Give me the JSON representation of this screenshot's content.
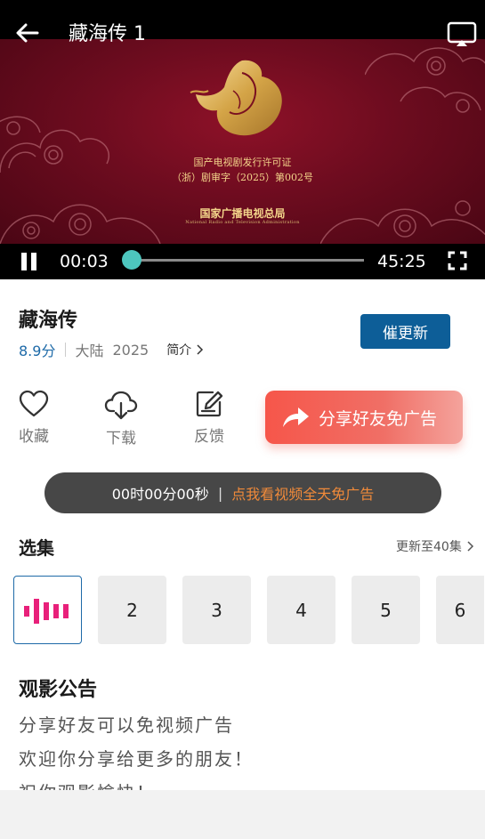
{
  "player": {
    "title": "藏海传 1",
    "frame_text": {
      "line1": "国产电视剧发行许可证",
      "line2": "（浙）剧审字（2025）第002号",
      "line3": "国家广播电视总局",
      "line4": "National Radio and Television Administration"
    },
    "current_time": "00:03",
    "total_time": "45:25",
    "progress": 0.001
  },
  "show": {
    "title": "藏海传",
    "rating": "8.9分",
    "region": "大陆",
    "year": "2025",
    "intro_label": "简介",
    "remind_label": "催更新"
  },
  "actions": {
    "favorite_label": "收藏",
    "download_label": "下载",
    "feedback_label": "反馈",
    "share_label": "分享好友免广告"
  },
  "ad_timer": {
    "time": "00时00分00秒",
    "separator": "|",
    "link": "点我看视频全天免广告"
  },
  "episodes": {
    "title": "选集",
    "updated": "更新至40集",
    "items": [
      "2",
      "3",
      "4",
      "5",
      "6"
    ]
  },
  "notice": {
    "title": "观影公告",
    "lines": [
      "分享好友可以免视频广告",
      "欢迎你分享给更多的朋友！",
      "祝你观影愉快！"
    ]
  },
  "colors": {
    "accent_blue": "#0d5e98",
    "rating_blue": "#1e6aa8",
    "seek_thumb": "#4dc6be",
    "ad_link": "#f08a3a",
    "share_red": "#f6564a",
    "playing_icon": "#e8207a"
  }
}
